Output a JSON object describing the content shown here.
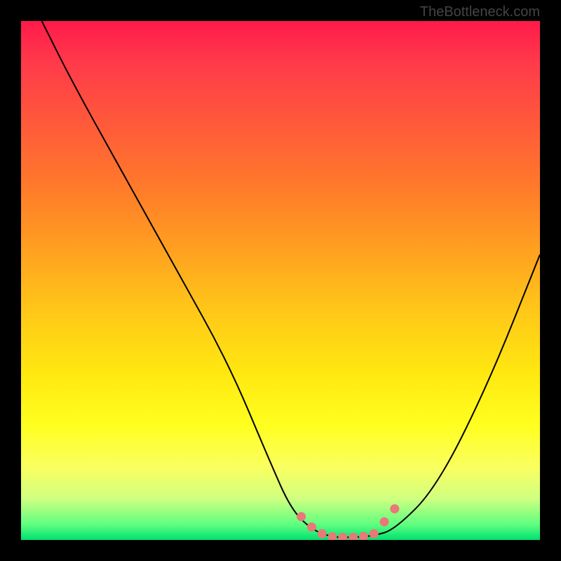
{
  "watermark": "TheBottleneck.com",
  "chart_data": {
    "type": "line",
    "title": "",
    "xlabel": "",
    "ylabel": "",
    "xlim": [
      0,
      100
    ],
    "ylim": [
      0,
      100
    ],
    "series": [
      {
        "name": "curve",
        "x": [
          4,
          10,
          20,
          30,
          40,
          48,
          52,
          56,
          60,
          64,
          68,
          72,
          80,
          90,
          100
        ],
        "y": [
          100,
          88,
          70,
          52,
          34,
          15,
          6,
          2,
          0.5,
          0.5,
          0.8,
          2,
          10,
          30,
          55
        ]
      },
      {
        "name": "markers",
        "x": [
          54,
          56,
          58,
          60,
          62,
          64,
          66,
          68,
          70,
          72
        ],
        "y": [
          4.5,
          2.5,
          1.2,
          0.6,
          0.5,
          0.5,
          0.7,
          1.2,
          3.5,
          6
        ]
      }
    ]
  }
}
